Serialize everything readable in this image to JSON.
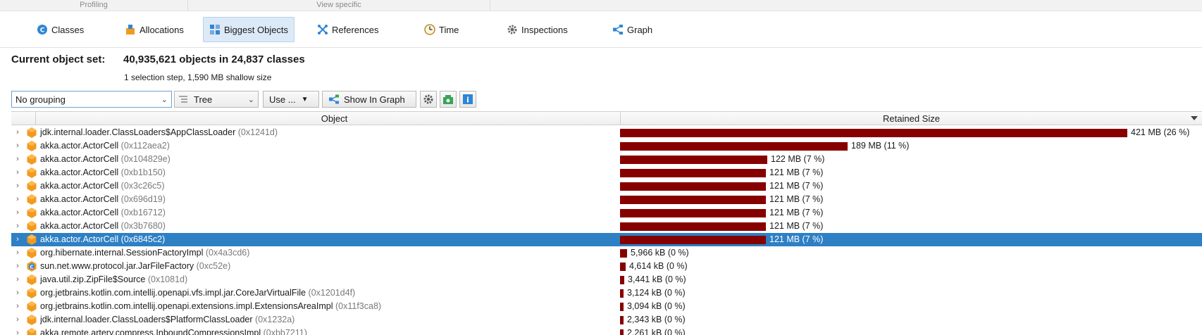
{
  "sections": {
    "profiling": "Profiling",
    "view_specific": "View specific"
  },
  "tabs": [
    {
      "label": "Classes",
      "icon": "classes-icon"
    },
    {
      "label": "Allocations",
      "icon": "allocations-icon"
    },
    {
      "label": "Biggest Objects",
      "icon": "biggest-objects-icon",
      "active": true
    },
    {
      "label": "References",
      "icon": "references-icon"
    },
    {
      "label": "Time",
      "icon": "time-icon"
    },
    {
      "label": "Inspections",
      "icon": "inspections-icon"
    },
    {
      "label": "Graph",
      "icon": "graph-icon"
    }
  ],
  "object_set": {
    "label": "Current object set:",
    "value": "40,935,621 objects in 24,837 classes",
    "detail": "1 selection step, 1,590 MB shallow size"
  },
  "toolbar": {
    "grouping": "No grouping",
    "view_mode": "Tree",
    "use_menu": "Use ...",
    "show_in_graph": "Show In Graph",
    "icons": [
      "settings-icon",
      "snapshot-icon",
      "info-icon"
    ]
  },
  "table": {
    "columns": [
      "Object",
      "Retained Size"
    ],
    "max_value_mb": 421,
    "rows": [
      {
        "class": "jdk.internal.loader.ClassLoaders$AppClassLoader",
        "addr": "(0x1241d)",
        "size": "421 MB (26 %)",
        "value_mb": 421,
        "icon": "object-icon"
      },
      {
        "class": "akka.actor.ActorCell",
        "addr": "(0x112aea2)",
        "size": "189 MB (11 %)",
        "value_mb": 189,
        "icon": "object-icon"
      },
      {
        "class": "akka.actor.ActorCell",
        "addr": "(0x104829e)",
        "size": "122 MB (7 %)",
        "value_mb": 122,
        "icon": "object-icon"
      },
      {
        "class": "akka.actor.ActorCell",
        "addr": "(0xb1b150)",
        "size": "121 MB (7 %)",
        "value_mb": 121,
        "icon": "object-icon"
      },
      {
        "class": "akka.actor.ActorCell",
        "addr": "(0x3c26c5)",
        "size": "121 MB (7 %)",
        "value_mb": 121,
        "icon": "object-icon"
      },
      {
        "class": "akka.actor.ActorCell",
        "addr": "(0x696d19)",
        "size": "121 MB (7 %)",
        "value_mb": 121,
        "icon": "object-icon"
      },
      {
        "class": "akka.actor.ActorCell",
        "addr": "(0xb16712)",
        "size": "121 MB (7 %)",
        "value_mb": 121,
        "icon": "object-icon"
      },
      {
        "class": "akka.actor.ActorCell",
        "addr": "(0x3b7680)",
        "size": "121 MB (7 %)",
        "value_mb": 121,
        "icon": "object-icon"
      },
      {
        "class": "akka.actor.ActorCell",
        "addr": "(0x6845c2)",
        "size": "121 MB (7 %)",
        "value_mb": 121,
        "icon": "object-icon",
        "selected": true
      },
      {
        "class": "org.hibernate.internal.SessionFactoryImpl",
        "addr": "(0x4a3cd6)",
        "size": "5,966 kB (0 %)",
        "value_mb": 5.966,
        "icon": "object-icon"
      },
      {
        "class": "sun.net.www.protocol.jar.JarFileFactory",
        "addr": "(0xc52e)",
        "size": "4,614 kB (0 %)",
        "value_mb": 4.614,
        "icon": "class-object-icon"
      },
      {
        "class": "java.util.zip.ZipFile$Source",
        "addr": "(0x1081d)",
        "size": "3,441 kB (0 %)",
        "value_mb": 3.441,
        "icon": "object-icon"
      },
      {
        "class": "org.jetbrains.kotlin.com.intellij.openapi.vfs.impl.jar.CoreJarVirtualFile",
        "addr": "(0x1201d4f)",
        "size": "3,124 kB (0 %)",
        "value_mb": 3.124,
        "icon": "object-icon"
      },
      {
        "class": "org.jetbrains.kotlin.com.intellij.openapi.extensions.impl.ExtensionsAreaImpl",
        "addr": "(0x11f3ca8)",
        "size": "3,094 kB (0 %)",
        "value_mb": 3.094,
        "icon": "object-icon"
      },
      {
        "class": "jdk.internal.loader.ClassLoaders$PlatformClassLoader",
        "addr": "(0x1232a)",
        "size": "2,343 kB (0 %)",
        "value_mb": 2.343,
        "icon": "object-icon"
      },
      {
        "class": "akka.remote.artery.compress.InboundCompressionsImpl",
        "addr": "(0xbb7211)",
        "size": "2,261 kB (0 %)",
        "value_mb": 2.261,
        "icon": "object-icon"
      }
    ]
  }
}
